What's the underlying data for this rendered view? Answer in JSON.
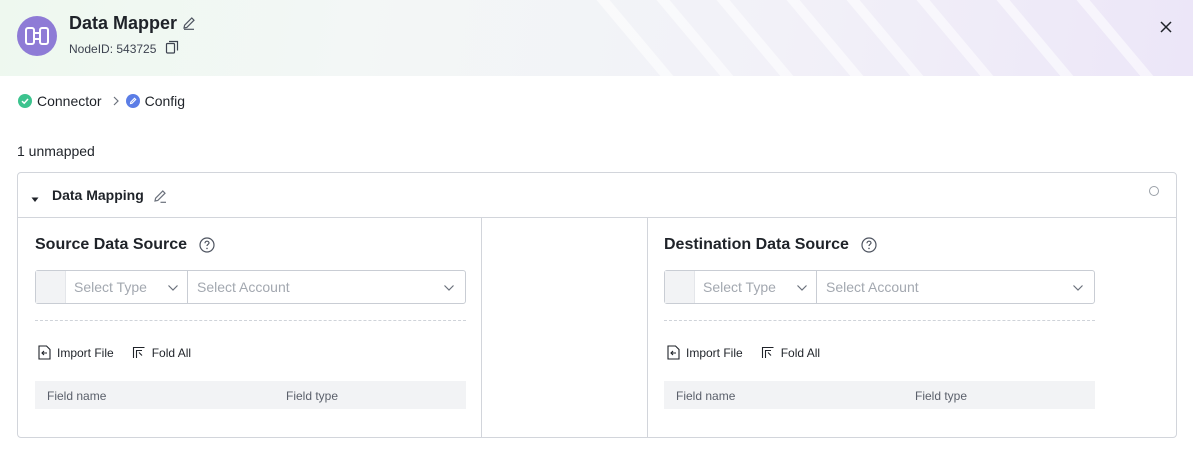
{
  "header": {
    "title": "Data Mapper",
    "node_id": "NodeID: 543725",
    "colors": {
      "node_icon_bg": "#8e7bd6"
    },
    "icons": [
      "mapper-node-icon",
      "pencil-icon",
      "copy-icon",
      "close-icon"
    ]
  },
  "steps": [
    {
      "label": "Connector",
      "state": "done",
      "color": "#3cc38e",
      "icon": "check-icon"
    },
    {
      "label": "Config",
      "state": "current",
      "color": "#5b7de6",
      "icon": "pencil-icon"
    }
  ],
  "summary": {
    "unmapped": "1 unmapped"
  },
  "panel": {
    "title": "Data Mapping",
    "expanded": true,
    "source": {
      "title": "Source Data Source",
      "type_placeholder": "Select Type",
      "account_placeholder": "Select Account",
      "import_label": "Import File",
      "fold_label": "Fold All",
      "col_name": "Field name",
      "col_type": "Field type"
    },
    "destination": {
      "title": "Destination Data Source",
      "type_placeholder": "Select Type",
      "account_placeholder": "Select Account",
      "import_label": "Import File",
      "fold_label": "Fold All",
      "col_name": "Field name",
      "col_type": "Field type"
    }
  }
}
